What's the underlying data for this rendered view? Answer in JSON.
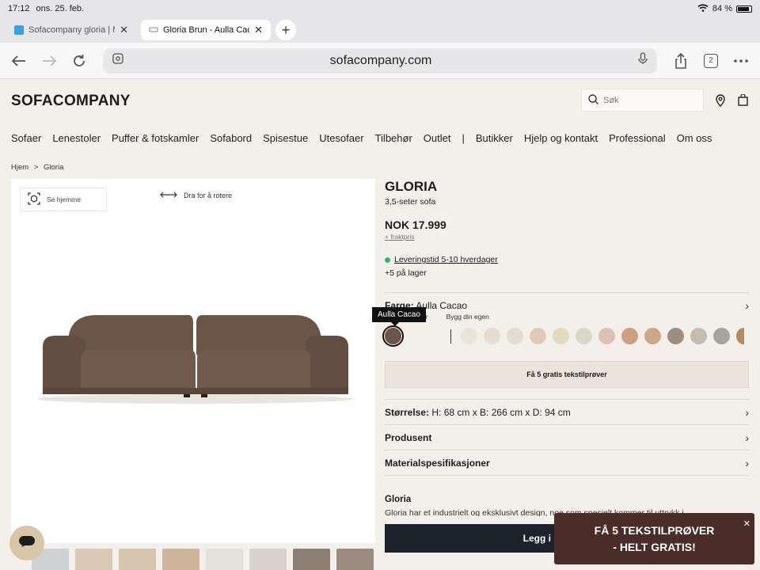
{
  "status": {
    "time": "17:12",
    "date": "ons. 25. feb.",
    "battery": "84 %"
  },
  "tabs": [
    {
      "title": "Sofacompany gloria | Ma",
      "active": false,
      "favicon_color": "#3aa0e0"
    },
    {
      "title": "Gloria Brun - Aulla Cacao",
      "active": true,
      "favicon_color": "#999999"
    }
  ],
  "browser": {
    "url": "sofacompany.com",
    "tab_count": "2"
  },
  "site": {
    "logo": "SOFACOMPANY",
    "search_placeholder": "Søk",
    "nav": [
      "Sofaer",
      "Lenestoler",
      "Puffer & fotskamler",
      "Sofabord",
      "Spisestue",
      "Utesofaer",
      "Tilbehør",
      "Outlet",
      "|",
      "Butikker",
      "Hjelp og kontakt",
      "Professional",
      "Om oss"
    ],
    "breadcrumb": [
      "Hjem",
      ">",
      "Gloria"
    ]
  },
  "gallery": {
    "see_home": "Se hjemme",
    "rotate_hint": "Dra for å rotere"
  },
  "product": {
    "name": "GLORIA",
    "subtitle": "3,5-seter sofa",
    "price": "NOK 17.999",
    "freight": "+ fraktpris",
    "delivery": "Leveringstid 5-10 hverdager",
    "stock": "+5 på lager",
    "color_label": "Farge:",
    "color_value": "Aulla Cacao",
    "tooltip": "Aulla Cacao",
    "swatch_label_partial": "er",
    "swatch_label_custom": "Bygg din egen",
    "swatches": [
      "#6b5448",
      "#ece3d9",
      "#e7ddd1",
      "#e3dcd3",
      "#e3c9b5",
      "#e3dbc0",
      "#d8d8c9",
      "#dcc3b1",
      "#cc9f83",
      "#cda787",
      "#9e8e80",
      "#c3bcaf",
      "#a8a39b",
      "#b58a63"
    ],
    "samples_button": "Få 5 gratis tekstilprøver",
    "size_label": "Størrelse:",
    "size_value": "H: 68 cm x B: 266 cm x D: 94 cm",
    "manufacturer": "Produsent",
    "materials": "Materialspesifikasjoner",
    "desc_title": "Gloria",
    "desc_text": "Gloria har et industrielt og eksklusivt design, noe som spesielt kommer til uttrykk i",
    "add_to_cart": "Legg i"
  },
  "promo": {
    "line1": "FÅ 5 TEKSTILPRØVER",
    "line2": "- HELT GRATIS!"
  }
}
